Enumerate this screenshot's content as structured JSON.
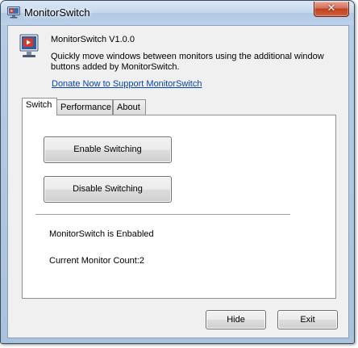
{
  "window": {
    "title": "MonitorSwitch"
  },
  "header": {
    "app_name": "MonitorSwitch V1.0.0",
    "description": "Quickly move windows between monitors using the additional window buttons added by MonitorSwitch.",
    "donate_link": "Donate Now to Support MonitorSwitch"
  },
  "tabs": [
    {
      "label": "Switch",
      "active": true
    },
    {
      "label": "Performance",
      "active": false
    },
    {
      "label": "About",
      "active": false
    }
  ],
  "switch_tab": {
    "enable_button": "Enable Switching",
    "disable_button": "Disable Switching",
    "status_text": "MonitorSwitch is Enbabled",
    "monitor_count_text": "Current Monitor Count:2"
  },
  "footer": {
    "hide_button": "Hide",
    "exit_button": "Exit"
  },
  "icons": {
    "title_icon": "monitor-icon",
    "app_icon": "monitor-play-icon",
    "close_icon": "close-icon"
  },
  "colors": {
    "link": "#0645ad",
    "close_button": "#c0411f",
    "icon_red": "#d23a2a"
  }
}
